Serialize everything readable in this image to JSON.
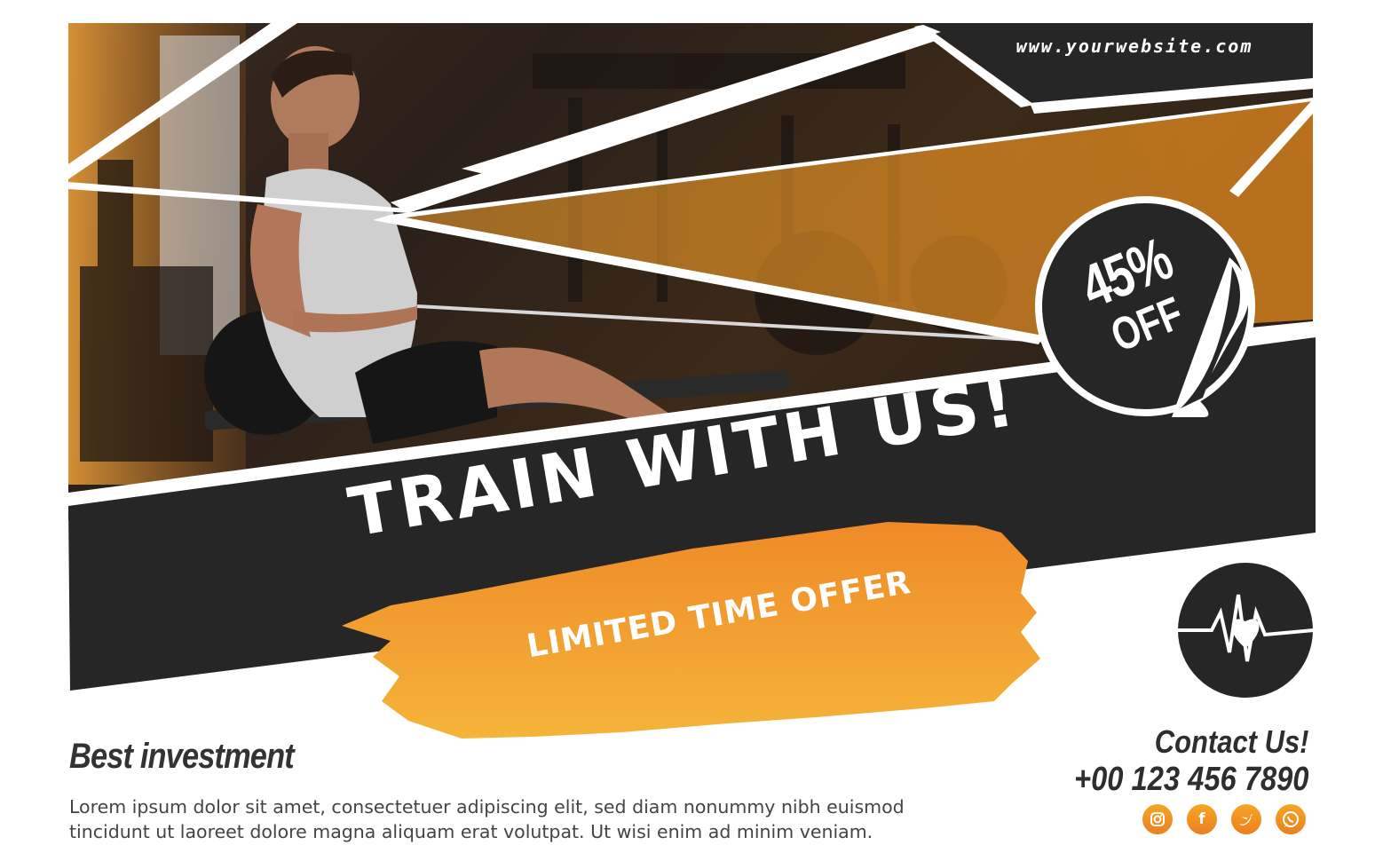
{
  "website": "www.yourwebsite.com",
  "badge": {
    "percent": "45%",
    "off": "OFF"
  },
  "headline": "TRAIN WITH US!",
  "offer": "LIMITED TIME OFFER",
  "investment": {
    "title": "Best investment",
    "lines": [
      "Lorem ipsum dolor sit amet, consectetuer adipiscing elit, sed diam nonummy nibh euismod",
      "tincidunt ut laoreet dolore magna aliquam erat volutpat. Ut wisi enim ad minim veniam."
    ]
  },
  "contact": {
    "title": "Contact Us!",
    "phone": "+00 123 456 7890"
  },
  "social_icons": [
    "instagram-icon",
    "facebook-icon",
    "twitter-icon",
    "whatsapp-icon"
  ],
  "colors": {
    "dark": "#262626",
    "orange": "#f08a24",
    "light_orange": "#f6ad3a",
    "white": "#ffffff"
  },
  "logo_icon": "heartbeat-heart-icon"
}
